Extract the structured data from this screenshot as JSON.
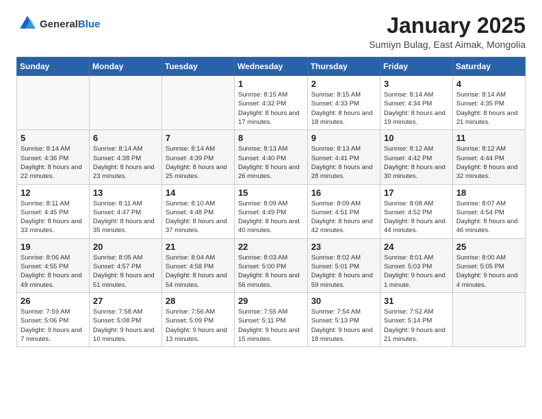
{
  "logo": {
    "general": "General",
    "blue": "Blue"
  },
  "header": {
    "month": "January 2025",
    "location": "Sumiyn Bulag, East Aimak, Mongolia"
  },
  "weekdays": [
    "Sunday",
    "Monday",
    "Tuesday",
    "Wednesday",
    "Thursday",
    "Friday",
    "Saturday"
  ],
  "weeks": [
    [
      {
        "day": "",
        "info": ""
      },
      {
        "day": "",
        "info": ""
      },
      {
        "day": "",
        "info": ""
      },
      {
        "day": "1",
        "info": "Sunrise: 8:15 AM\nSunset: 4:32 PM\nDaylight: 8 hours\nand 17 minutes."
      },
      {
        "day": "2",
        "info": "Sunrise: 8:15 AM\nSunset: 4:33 PM\nDaylight: 8 hours\nand 18 minutes."
      },
      {
        "day": "3",
        "info": "Sunrise: 8:14 AM\nSunset: 4:34 PM\nDaylight: 8 hours\nand 19 minutes."
      },
      {
        "day": "4",
        "info": "Sunrise: 8:14 AM\nSunset: 4:35 PM\nDaylight: 8 hours\nand 21 minutes."
      }
    ],
    [
      {
        "day": "5",
        "info": "Sunrise: 8:14 AM\nSunset: 4:36 PM\nDaylight: 8 hours\nand 22 minutes."
      },
      {
        "day": "6",
        "info": "Sunrise: 8:14 AM\nSunset: 4:38 PM\nDaylight: 8 hours\nand 23 minutes."
      },
      {
        "day": "7",
        "info": "Sunrise: 8:14 AM\nSunset: 4:39 PM\nDaylight: 8 hours\nand 25 minutes."
      },
      {
        "day": "8",
        "info": "Sunrise: 8:13 AM\nSunset: 4:40 PM\nDaylight: 8 hours\nand 26 minutes."
      },
      {
        "day": "9",
        "info": "Sunrise: 8:13 AM\nSunset: 4:41 PM\nDaylight: 8 hours\nand 28 minutes."
      },
      {
        "day": "10",
        "info": "Sunrise: 8:12 AM\nSunset: 4:42 PM\nDaylight: 8 hours\nand 30 minutes."
      },
      {
        "day": "11",
        "info": "Sunrise: 8:12 AM\nSunset: 4:44 PM\nDaylight: 8 hours\nand 32 minutes."
      }
    ],
    [
      {
        "day": "12",
        "info": "Sunrise: 8:11 AM\nSunset: 4:45 PM\nDaylight: 8 hours\nand 33 minutes."
      },
      {
        "day": "13",
        "info": "Sunrise: 8:11 AM\nSunset: 4:47 PM\nDaylight: 8 hours\nand 35 minutes."
      },
      {
        "day": "14",
        "info": "Sunrise: 8:10 AM\nSunset: 4:48 PM\nDaylight: 8 hours\nand 37 minutes."
      },
      {
        "day": "15",
        "info": "Sunrise: 8:09 AM\nSunset: 4:49 PM\nDaylight: 8 hours\nand 40 minutes."
      },
      {
        "day": "16",
        "info": "Sunrise: 8:09 AM\nSunset: 4:51 PM\nDaylight: 8 hours\nand 42 minutes."
      },
      {
        "day": "17",
        "info": "Sunrise: 8:08 AM\nSunset: 4:52 PM\nDaylight: 8 hours\nand 44 minutes."
      },
      {
        "day": "18",
        "info": "Sunrise: 8:07 AM\nSunset: 4:54 PM\nDaylight: 8 hours\nand 46 minutes."
      }
    ],
    [
      {
        "day": "19",
        "info": "Sunrise: 8:06 AM\nSunset: 4:55 PM\nDaylight: 8 hours\nand 49 minutes."
      },
      {
        "day": "20",
        "info": "Sunrise: 8:05 AM\nSunset: 4:57 PM\nDaylight: 8 hours\nand 51 minutes."
      },
      {
        "day": "21",
        "info": "Sunrise: 8:04 AM\nSunset: 4:58 PM\nDaylight: 8 hours\nand 54 minutes."
      },
      {
        "day": "22",
        "info": "Sunrise: 8:03 AM\nSunset: 5:00 PM\nDaylight: 8 hours\nand 56 minutes."
      },
      {
        "day": "23",
        "info": "Sunrise: 8:02 AM\nSunset: 5:01 PM\nDaylight: 8 hours\nand 59 minutes."
      },
      {
        "day": "24",
        "info": "Sunrise: 8:01 AM\nSunset: 5:03 PM\nDaylight: 9 hours\nand 1 minute."
      },
      {
        "day": "25",
        "info": "Sunrise: 8:00 AM\nSunset: 5:05 PM\nDaylight: 9 hours\nand 4 minutes."
      }
    ],
    [
      {
        "day": "26",
        "info": "Sunrise: 7:59 AM\nSunset: 5:06 PM\nDaylight: 9 hours\nand 7 minutes."
      },
      {
        "day": "27",
        "info": "Sunrise: 7:58 AM\nSunset: 5:08 PM\nDaylight: 9 hours\nand 10 minutes."
      },
      {
        "day": "28",
        "info": "Sunrise: 7:56 AM\nSunset: 5:09 PM\nDaylight: 9 hours\nand 13 minutes."
      },
      {
        "day": "29",
        "info": "Sunrise: 7:55 AM\nSunset: 5:11 PM\nDaylight: 9 hours\nand 15 minutes."
      },
      {
        "day": "30",
        "info": "Sunrise: 7:54 AM\nSunset: 5:13 PM\nDaylight: 9 hours\nand 18 minutes."
      },
      {
        "day": "31",
        "info": "Sunrise: 7:52 AM\nSunset: 5:14 PM\nDaylight: 9 hours\nand 21 minutes."
      },
      {
        "day": "",
        "info": ""
      }
    ]
  ]
}
